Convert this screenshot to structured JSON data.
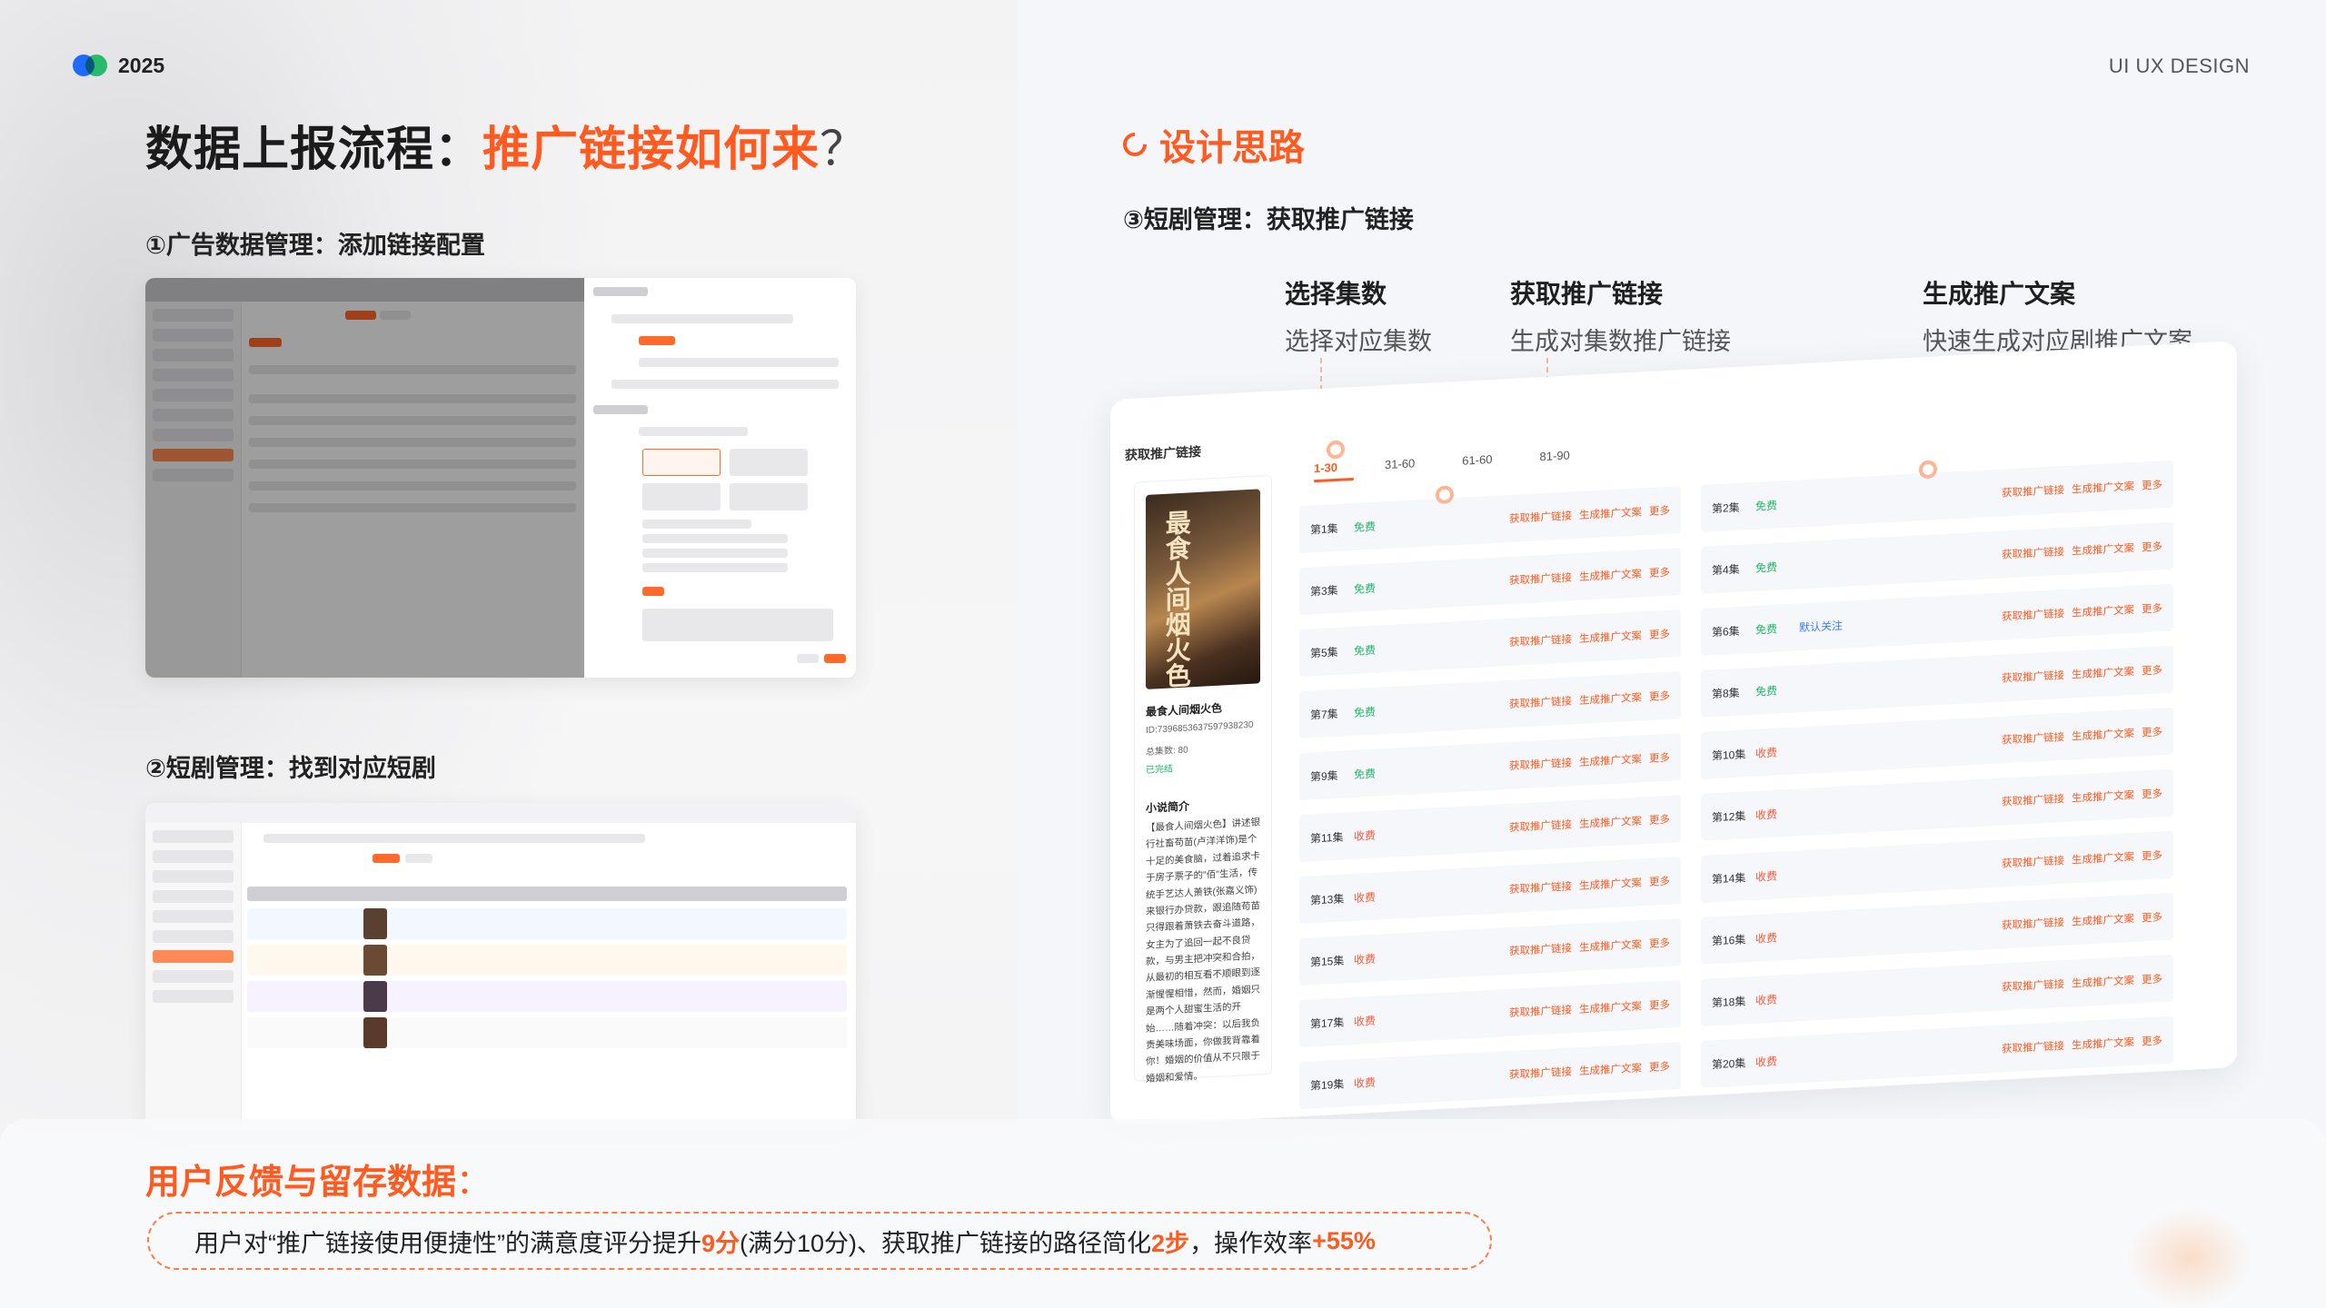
{
  "header": {
    "year": "2025",
    "tag": "UI UX DESIGN"
  },
  "title": {
    "prefix": "数据上报流程：",
    "highlight": "推广链接如何来",
    "suffix": "？"
  },
  "steps": {
    "step1": "①广告数据管理：添加链接配置",
    "step2": "②短剧管理：找到对应短剧",
    "step3": "③短剧管理：获取推广链接"
  },
  "design": {
    "title": "设计思路"
  },
  "annotations": [
    {
      "title": "选择集数",
      "desc": "选择对应集数"
    },
    {
      "title": "获取推广链接",
      "desc": "生成对集数推广链接"
    },
    {
      "title": "生成推广文案",
      "desc": "快速生成对应剧推广文案"
    }
  ],
  "card": {
    "title": "获取推广链接",
    "drama": {
      "poster_text": "最食人间烟火色",
      "name": "最食人间烟火色",
      "id": "ID:7396853637597938230",
      "episodes": "总集数: 80",
      "status": "已完结",
      "intro_heading": "小说简介",
      "intro": "【最食人间烟火色】讲述银行社畜苟苗(卢洋洋饰)是个十足的美食脑，过着追求卡于房子票子的\"佰\"生活，传统手艺达人萧铁(张嘉义饰)来银行办贷款，跟追随苟苗只得跟着萧铁去奋斗道路，女主为了追回一起不良贷款，与男主把冲突和合拍，从最初的相互看不顺眼到逐渐惺惺相惜，然而，婚姻只是两个人甜蜜生活的开始……随着冲突：以后我负责美味场面，你做我背靠着你！婚姻的价值从不只限于婚姻和爱情。"
    },
    "tabs": [
      "1-30",
      "31-60",
      "61-60",
      "81-90"
    ],
    "actions": {
      "link": "获取推广链接",
      "copy": "生成推广文案",
      "more": "更多"
    },
    "episodes": [
      {
        "label": "第1集",
        "status": "免费",
        "type": "free"
      },
      {
        "label": "第2集",
        "status": "免费",
        "type": "free"
      },
      {
        "label": "第3集",
        "status": "免费",
        "type": "free"
      },
      {
        "label": "第4集",
        "status": "免费",
        "type": "free"
      },
      {
        "label": "第5集",
        "status": "免费",
        "type": "free"
      },
      {
        "label": "第6集",
        "status": "免费",
        "type": "free",
        "extra": "默认关注"
      },
      {
        "label": "第7集",
        "status": "免费",
        "type": "free"
      },
      {
        "label": "第8集",
        "status": "免费",
        "type": "free"
      },
      {
        "label": "第9集",
        "status": "免费",
        "type": "free"
      },
      {
        "label": "第10集",
        "status": "收费",
        "type": "paid"
      },
      {
        "label": "第11集",
        "status": "收费",
        "type": "paid"
      },
      {
        "label": "第12集",
        "status": "收费",
        "type": "paid"
      },
      {
        "label": "第13集",
        "status": "收费",
        "type": "paid"
      },
      {
        "label": "第14集",
        "status": "收费",
        "type": "paid"
      },
      {
        "label": "第15集",
        "status": "收费",
        "type": "paid"
      },
      {
        "label": "第16集",
        "status": "收费",
        "type": "paid"
      },
      {
        "label": "第17集",
        "status": "收费",
        "type": "paid"
      },
      {
        "label": "第18集",
        "status": "收费",
        "type": "paid"
      },
      {
        "label": "第19集",
        "status": "收费",
        "type": "paid"
      },
      {
        "label": "第20集",
        "status": "收费",
        "type": "paid"
      }
    ]
  },
  "feedback": {
    "title": "用户反馈与留存数据",
    "colon": "：",
    "t1": "用户对“推广链接使用便捷性”的满意度评分提升",
    "v1": "9分",
    "t2": "(满分10分)、获取推广链接的路径简化",
    "v2": "2步",
    "t3": "，操作效率",
    "v3": "+55%"
  },
  "colors": {
    "accent": "#ff5a1f",
    "free": "#22b566",
    "paid": "#ff5a3a",
    "brand_blue": "#1f6bff",
    "brand_green": "#2ed07a"
  }
}
